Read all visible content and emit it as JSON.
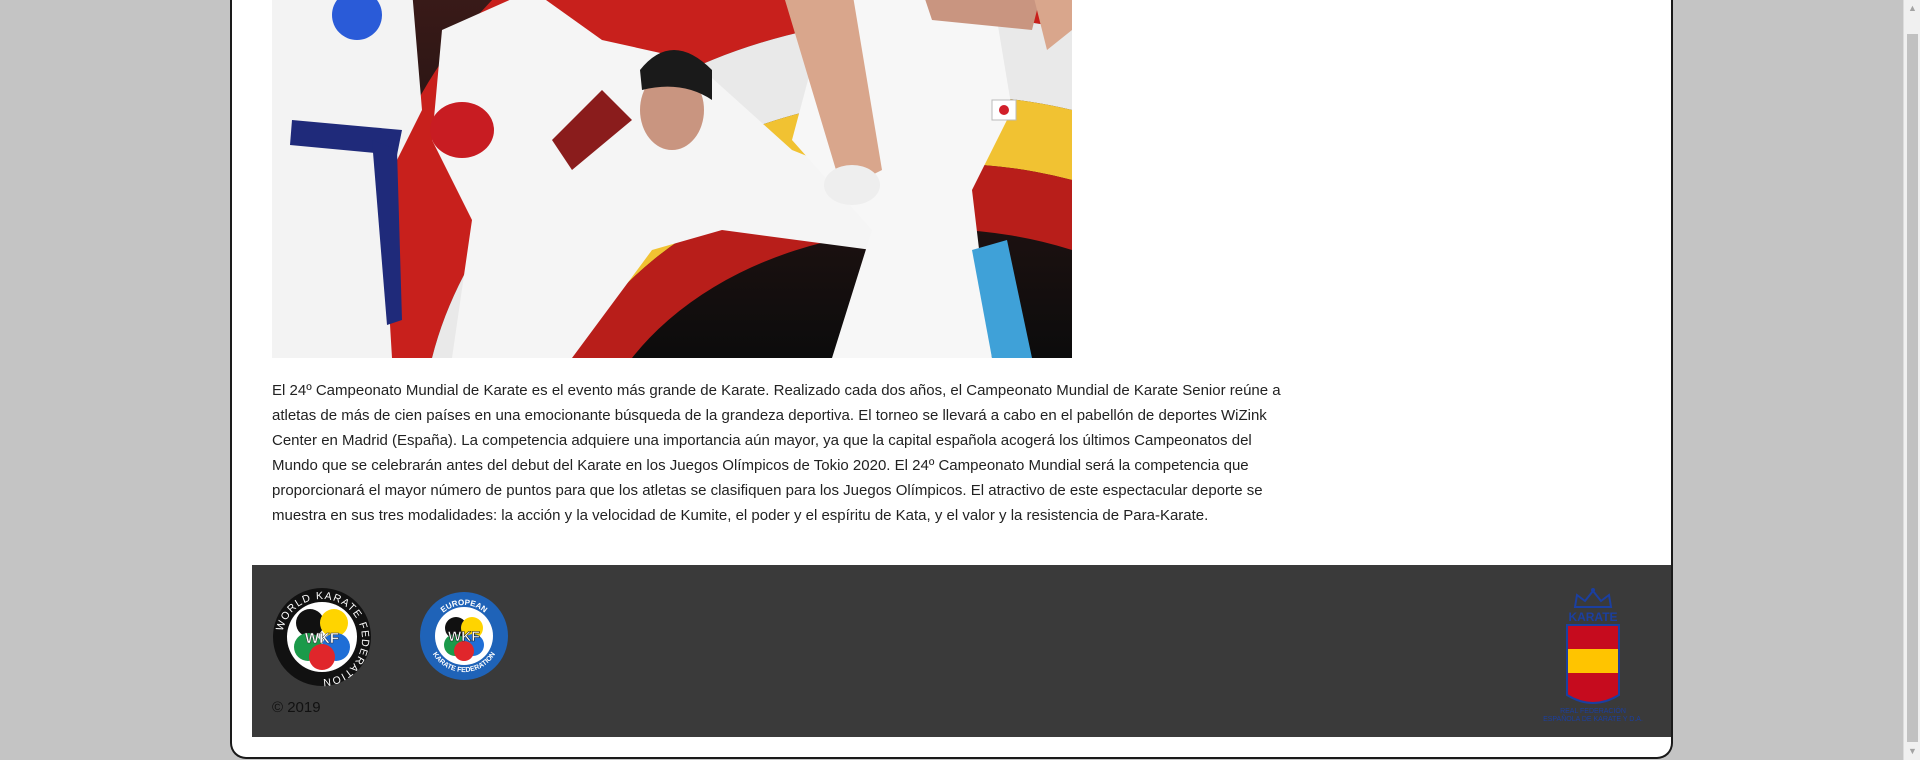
{
  "article": {
    "paragraph": "El 24º Campeonato Mundial de Karate es el evento más grande de Karate. Realizado cada dos años, el Campeonato Mundial de Karate Senior reúne a atletas de más de cien países en una emocionante búsqueda de la grandeza deportiva. El torneo se llevará a cabo en el pabellón de deportes WiZink Center en Madrid (España). La competencia adquiere una importancia aún mayor, ya que la capital española acogerá los últimos Campeonatos del Mundo que se celebrarán antes del debut del Karate en los Juegos Olímpicos de Tokio 2020. El 24º Campeonato Mundial será la competencia que proporcionará el mayor número de puntos para que los atletas se clasifiquen para los Juegos Olímpicos. El atractivo de este espectacular deporte se muestra en sus tres modalidades: la acción y la velocidad de Kumite, el poder y el espíritu de Kata, y el valor y la resistencia de Para-Karate."
  },
  "footer": {
    "copyright": "© 2019",
    "logos": {
      "wkf": {
        "ring_text": "WORLD KARATE FEDERATION",
        "center": "WKF"
      },
      "ekf": {
        "top_text": "EUROPEAN",
        "center": "WKF",
        "bottom_text": "KARATE FEDERATION"
      },
      "rfek": {
        "title": "KARATE",
        "line1": "REAL FEDERACIÓN",
        "line2": "ESPAÑOLA DE KARATE Y D.A."
      }
    }
  },
  "colors": {
    "page_background": "#c4c4c4",
    "footer_background": "#3a3a3a",
    "spain_red": "#c60b1e",
    "spain_yellow": "#ffc400",
    "rfek_blue": "#1b3fa0"
  },
  "icons": {
    "scroll_up": "▲",
    "scroll_down": "▼"
  }
}
